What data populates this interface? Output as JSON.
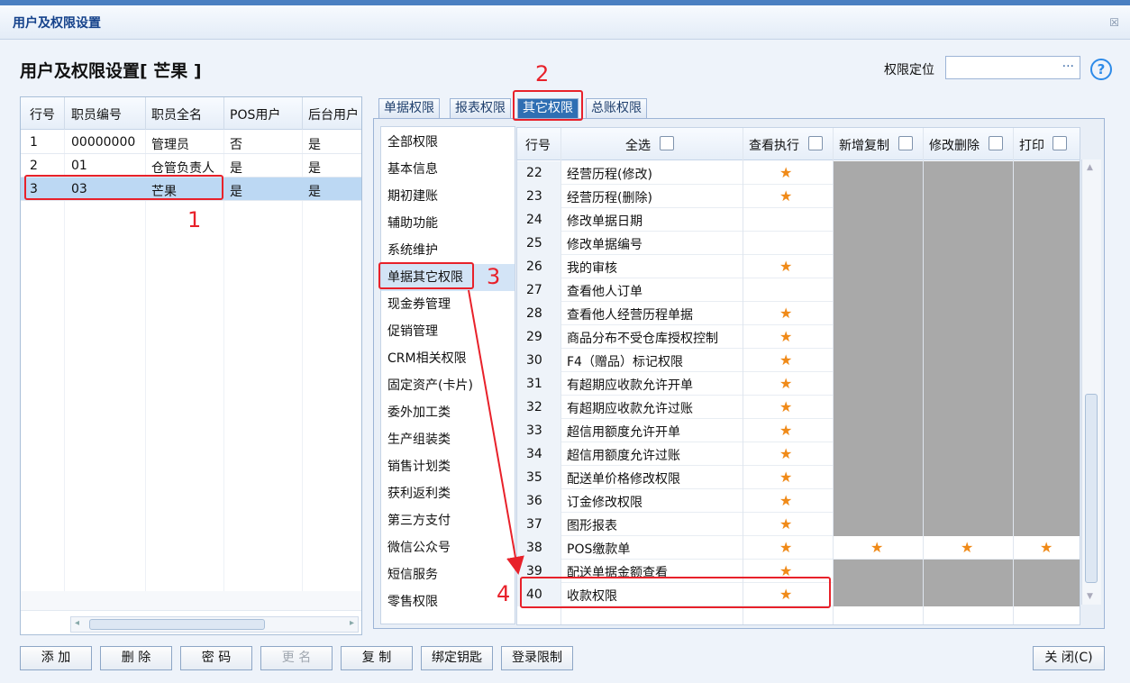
{
  "window": {
    "title": "用户及权限设置",
    "close_glyph": "☒"
  },
  "heading": "用户及权限设置[ 芒果 ]",
  "locate": {
    "label": "权限定位",
    "value": "",
    "dots": "···",
    "help": "?"
  },
  "users": {
    "columns": [
      "行号",
      "职员编号",
      "职员全名",
      "POS用户",
      "后台用户"
    ],
    "rows": [
      [
        "1",
        "00000000",
        "管理员",
        "否",
        "是"
      ],
      [
        "2",
        "01",
        "仓管负责人",
        "是",
        "是"
      ],
      [
        "3",
        "03",
        "芒果",
        "是",
        "是"
      ]
    ],
    "scroll_left": "◂",
    "scroll_right": "▸"
  },
  "tabs": [
    "单据权限",
    "报表权限",
    "其它权限",
    "总账权限"
  ],
  "categories": [
    "全部权限",
    "基本信息",
    "期初建账",
    "辅助功能",
    "系统维护",
    "单据其它权限",
    "现金券管理",
    "促销管理",
    "CRM相关权限",
    "固定资产(卡片)",
    "委外加工类",
    "生产组装类",
    "销售计划类",
    "获利返利类",
    "第三方支付",
    "微信公众号",
    "短信服务",
    "零售权限"
  ],
  "perm_grid": {
    "columns": {
      "row": "行号",
      "select_all": "全选",
      "view": "查看执行",
      "add": "新增复制",
      "edit": "修改删除",
      "print": "打印"
    },
    "star": "★",
    "rows": [
      {
        "no": "22",
        "name": "经营历程(修改)",
        "view": true
      },
      {
        "no": "23",
        "name": "经营历程(删除)",
        "view": true
      },
      {
        "no": "24",
        "name": "修改单据日期",
        "view": false
      },
      {
        "no": "25",
        "name": "修改单据编号",
        "view": false
      },
      {
        "no": "26",
        "name": "我的审核",
        "view": true
      },
      {
        "no": "27",
        "name": "查看他人订单",
        "view": false
      },
      {
        "no": "28",
        "name": "查看他人经营历程单据",
        "view": true
      },
      {
        "no": "29",
        "name": "商品分布不受仓库授权控制",
        "view": true
      },
      {
        "no": "30",
        "name": "F4（赠品）标记权限",
        "view": true
      },
      {
        "no": "31",
        "name": "有超期应收款允许开单",
        "view": true
      },
      {
        "no": "32",
        "name": "有超期应收款允许过账",
        "view": true
      },
      {
        "no": "33",
        "name": "超信用额度允许开单",
        "view": true
      },
      {
        "no": "34",
        "name": "超信用额度允许过账",
        "view": true
      },
      {
        "no": "35",
        "name": "配送单价格修改权限",
        "view": true
      },
      {
        "no": "36",
        "name": "订金修改权限",
        "view": true
      },
      {
        "no": "37",
        "name": "图形报表",
        "view": true
      },
      {
        "no": "38",
        "name": "POS缴款单",
        "view": true,
        "all": true
      },
      {
        "no": "39",
        "name": "配送单据金额查看",
        "view": true
      },
      {
        "no": "40",
        "name": "收款权限",
        "view": true
      }
    ],
    "scroll_up": "▲",
    "scroll_down": "▼"
  },
  "buttons": {
    "add": "添 加",
    "delete": "删 除",
    "password": "密 码",
    "rename": "更 名",
    "copy": "复 制",
    "bind_key": "绑定钥匙",
    "login_limit": "登录限制",
    "close": "关 闭(C)"
  },
  "annotations": [
    "1",
    "2",
    "3",
    "4"
  ]
}
